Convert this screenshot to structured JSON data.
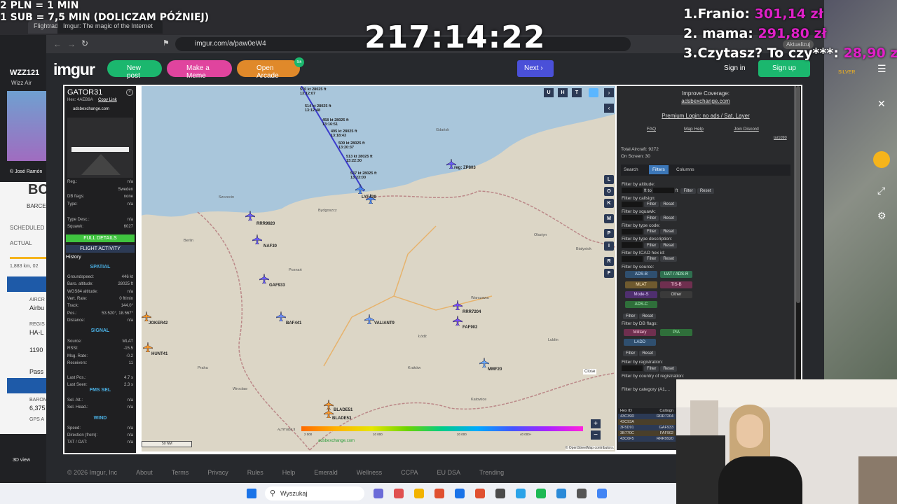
{
  "overlay": {
    "line1": "2 PLN = 1 MIN",
    "line2": "1 SUB = 7,5 MIN (DOLICZAM PÓŹNIEJ)",
    "timer": "217:14:22",
    "ranks": [
      {
        "label": "1.Franio: ",
        "amount": "301,14 zł"
      },
      {
        "label": "2. mama: ",
        "amount": "291,80 zł"
      },
      {
        "label": "3.Czytasz? To czy***: ",
        "amount": "28,90 zł"
      }
    ]
  },
  "browser": {
    "tab1": "Flightradar24: Live Flight Track...",
    "tab2": "Imgur: The magic of the Internet",
    "url": "imgur.com/a/paw0eW4",
    "update": "Aktualizuj"
  },
  "left_page": {
    "flight": "WZZ121",
    "airline": "Wizz Air",
    "photo": "© José Ramón",
    "code": "BC",
    "city": "BARCE",
    "scheduled": "SCHEDULED",
    "actual": "ACTUAL",
    "dist": "1,883 km, 02",
    "aircraft": "AIRCR",
    "type": "Airbu",
    "reg": "REGIS",
    "reg_val": "HA-L",
    "alt": "1190",
    "pass": "Pass",
    "baro": "BAROM",
    "baro_val": "6,375",
    "gps": "GPS A",
    "view": "3D view"
  },
  "right_page": {
    "silver": "SILVER"
  },
  "imgur": {
    "logo": "imgur",
    "new_post": "New post",
    "make_meme": "Make a Meme",
    "open_arcade": "Open Arcade",
    "badge": "5th",
    "next": "Next",
    "sign_in": "Sign in",
    "sign_up": "Sign up",
    "footer": [
      "© 2026 Imgur, Inc",
      "About",
      "Terms",
      "Privacy",
      "Rules",
      "Help",
      "Emerald",
      "Wellness",
      "CCPA",
      "EU DSA",
      "Trending"
    ]
  },
  "sidebar": {
    "callsign": "GATOR31",
    "hex_label": "Hex:",
    "hex": "4AEB9A",
    "copy_link": "Copy Link",
    "source": "adsbexchange.com",
    "rows1": [
      [
        "Reg.:",
        "n/a"
      ],
      [
        "",
        "Sweden"
      ],
      [
        "DB flags:",
        "none"
      ],
      [
        "Type:",
        "n/a"
      ],
      [
        "",
        ""
      ],
      [
        "Type Desc.:",
        "n/a"
      ],
      [
        "Squawk:",
        "6027"
      ]
    ],
    "full_details": "FULL DETAILS",
    "flight_activity": "FLIGHT ACTIVITY",
    "history": "History",
    "spatial": "SPATIAL",
    "spatial_rows": [
      [
        "Groundspeed:",
        "446 kt"
      ],
      [
        "Baro. altitude:",
        "28025 ft"
      ],
      [
        "WGS84 altitude:",
        "n/a"
      ],
      [
        "Vert. Rate:",
        "0 ft/min"
      ],
      [
        "Track:",
        "144.0°"
      ],
      [
        "Pos.:",
        "53.520°, 18.567°"
      ],
      [
        "Distance:",
        "n/a"
      ]
    ],
    "signal": "SIGNAL",
    "signal_rows": [
      [
        "Source:",
        "MLAT"
      ],
      [
        "RSSI:",
        "-15.5"
      ],
      [
        "Msg. Rate:",
        "-0.2"
      ],
      [
        "Receivers:",
        "11"
      ],
      [
        "",
        ""
      ],
      [
        "Last Pos.:",
        "4.7 s"
      ],
      [
        "Last Seen:",
        "2.3 s"
      ]
    ],
    "fms": "FMS SEL",
    "fms_rows": [
      [
        "Sel. Alt.:",
        "n/a"
      ],
      [
        "Sel. Head.:",
        "n/a"
      ]
    ],
    "wind": "WIND",
    "wind_rows": [
      [
        "Speed:",
        "n/a"
      ],
      [
        "Direction (from):",
        "n/a"
      ],
      [
        "TAT / OAT:",
        "n/a"
      ]
    ]
  },
  "map": {
    "track_labels": [
      "570 kt 28025 ft 13:12:07",
      "514 kt 28025 ft 13:12:48",
      "458 kt 28025 ft 13:16:51",
      "495 kt 28025 ft 13:18:43",
      "509 kt 28025 ft 13:20:37",
      "513 kt 28025 ft 13:22:30",
      "537 kt 28025 ft 13:23:00"
    ],
    "planes": [
      "GATOR31",
      "LYF439",
      "reg: ZP803",
      "RRR9920",
      "NAF30",
      "GAF933",
      "BAF441",
      "VALIANT9",
      "RRR7204",
      "FAF902",
      "MMF20",
      "JOKER42",
      "HUNT41",
      "BLADE51",
      "BLADE53"
    ],
    "cities": [
      "Szczecin",
      "Bydgoszcz",
      "Gdańsk",
      "Berlin",
      "Poznań",
      "Warszawa",
      "Łódź",
      "Wrocław",
      "Kraków",
      "Praha",
      "Lublin",
      "Olsztyn",
      "Białystok",
      "Katowice"
    ],
    "close": "Close",
    "scale": "50 NM",
    "altitude_label": "ALTITUDE ft",
    "alt_ticks": [
      "2 000",
      "10 000",
      "20 000",
      "40 000+"
    ],
    "attrib": "© OpenStreetMap contributors.",
    "watermark": "adsbexchange.com",
    "buttons": [
      "U",
      "H",
      "T"
    ],
    "side_buttons": [
      "L",
      "O",
      "K",
      "M",
      "P",
      "I",
      "R",
      "F"
    ]
  },
  "panel": {
    "improve": "Improve Coverage:",
    "improve_link": "adsbexchange.com",
    "premium": "Premium Login: no ads / Sat. Layer",
    "faq": "FAQ",
    "map_help": "Map Help",
    "join": "Join Discord",
    "user": "tar1090",
    "total": "Total Aircraft: 9272",
    "on_screen": "On Screen: 30",
    "tabs": [
      "Search",
      "Filters",
      "Columns"
    ],
    "filters": [
      "Filter by altitude:",
      "Filter by callsign:",
      "Filter by squawk:",
      "Filter by type code:",
      "Filter by type description:",
      "Filter by ICAO hex id:"
    ],
    "ft_to": "ft to",
    "ft": "ft",
    "filter_btn": "Filter",
    "reset_btn": "Reset",
    "source_label": "Filter by source:",
    "sources": [
      "ADS-B",
      "UAT / ADS-R",
      "MLAT",
      "TIS-B",
      "Mode-S",
      "Other",
      "ADS-C"
    ],
    "db_label": "Filter by DB flags:",
    "db_flags": [
      "Military",
      "PIA",
      "LADD"
    ],
    "reg_label": "Filter by registration:",
    "country_label": "Filter by country of registration:",
    "category_label": "Filter by category (A1,...",
    "table_head": [
      "Hex ID",
      "Callsign"
    ],
    "table": [
      [
        "43C39D",
        "RRR7204"
      ],
      [
        "43C93A",
        ""
      ],
      [
        "3F5D91",
        "GAF933"
      ],
      [
        "3B770C",
        "FAF902"
      ],
      [
        "43C6F5",
        "RRR9920"
      ]
    ]
  },
  "taskbar": {
    "search": "Wyszukaj"
  }
}
